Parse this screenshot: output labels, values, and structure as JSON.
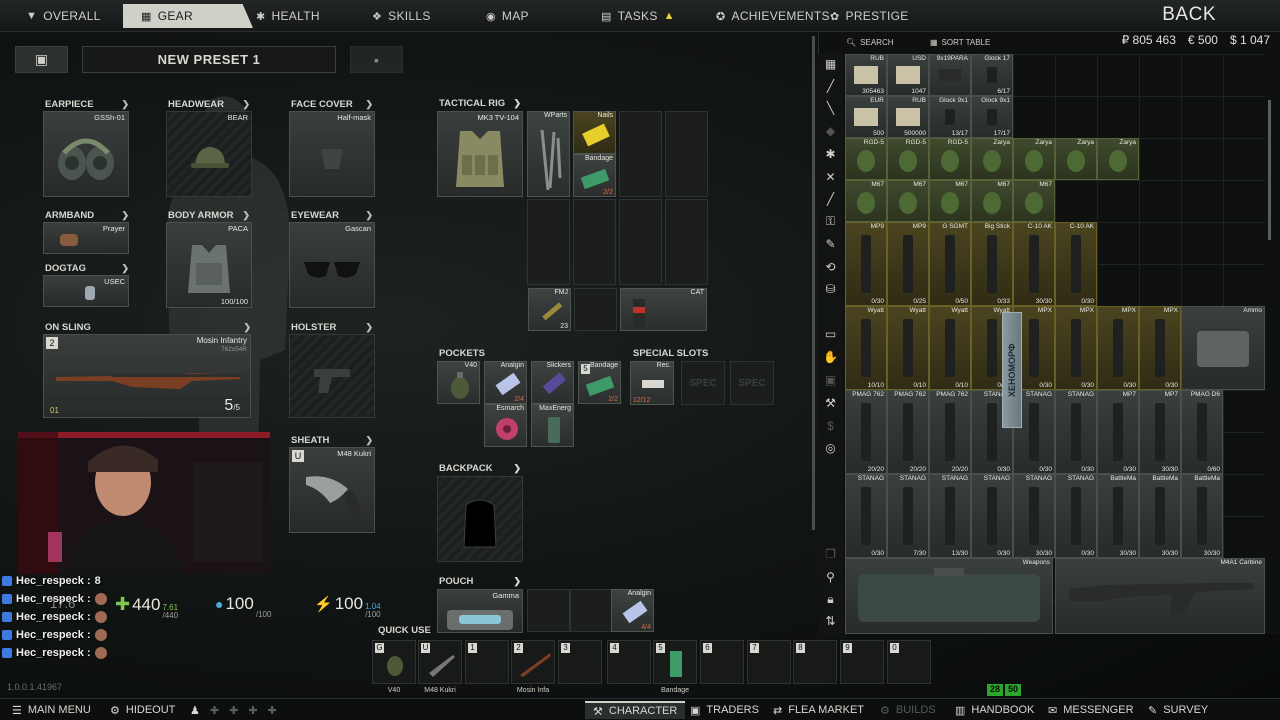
{
  "top_tabs": [
    {
      "label": "OVERALL",
      "icon": "person-icon"
    },
    {
      "label": "GEAR",
      "icon": "gear-icon"
    },
    {
      "label": "HEALTH",
      "icon": "health-icon"
    },
    {
      "label": "SKILLS",
      "icon": "skills-icon"
    },
    {
      "label": "MAP",
      "icon": "map-pin-icon"
    },
    {
      "label": "TASKS",
      "icon": "tasks-icon"
    },
    {
      "label": "ACHIEVEMENTS",
      "icon": "achievements-icon"
    },
    {
      "label": "PRESTIGE",
      "icon": "prestige-icon"
    }
  ],
  "back_label": "BACK",
  "preset": {
    "name": "NEW PRESET 1"
  },
  "equipment": {
    "earpiece": {
      "label": "EARPIECE",
      "item": "GSSh-01"
    },
    "headwear": {
      "label": "HEADWEAR",
      "item": "BEAR"
    },
    "face_cover": {
      "label": "FACE COVER",
      "item": "Half-mask"
    },
    "armband": {
      "label": "ARMBAND",
      "item": "Prayer"
    },
    "body_armor": {
      "label": "BODY ARMOR",
      "item": "PACA",
      "durability": "100/100"
    },
    "eyewear": {
      "label": "EYEWEAR",
      "item": "Gascan"
    },
    "dogtag": {
      "label": "DOGTAG",
      "item": "USEC"
    },
    "on_sling": {
      "label": "ON SLING",
      "item": "Mosin Infantry",
      "caliber": "762x54R",
      "ammo": "5",
      "ammo_max": "/5",
      "slot_key": "2",
      "mode": "01"
    },
    "holster": {
      "label": "HOLSTER"
    },
    "sheath": {
      "label": "SHEATH",
      "item": "M48 Kukri",
      "slot_key": "U"
    }
  },
  "tactical_rig": {
    "label": "TACTICAL RIG",
    "item": "MK3 TV-104",
    "items": [
      {
        "name": "WParts",
        "qty": ""
      },
      {
        "name": "Nails",
        "qty": ""
      },
      {
        "name": "Bandage",
        "qty": "2/2"
      },
      {
        "name": "FMJ",
        "qty": "23"
      },
      {
        "name": "CAT",
        "qty": ""
      }
    ]
  },
  "pockets": {
    "label": "POCKETS",
    "items": [
      {
        "name": "V40",
        "qty": ""
      },
      {
        "name": "Analgin",
        "qty": "2/4"
      },
      {
        "name": "Slickers",
        "qty": ""
      },
      {
        "name": "Bandage",
        "qty": "2/2",
        "key": "5"
      },
      {
        "name": "Esmarch",
        "qty": ""
      },
      {
        "name": "MaxEnerg",
        "qty": ""
      }
    ]
  },
  "special_slots": {
    "label": "SPECIAL SLOTS",
    "items": [
      {
        "name": "Rec.",
        "qty": "12/12"
      },
      {
        "name": "SPEC",
        "qty": ""
      },
      {
        "name": "SPEC",
        "qty": ""
      }
    ]
  },
  "backpack": {
    "label": "BACKPACK"
  },
  "pouch": {
    "label": "POUCH",
    "item": "Gamma",
    "content": {
      "name": "Analgin",
      "qty": "4/4"
    }
  },
  "player_stats": {
    "health": {
      "value": "440",
      "max": "/440",
      "top": "7.61"
    },
    "hydration": {
      "value": "100",
      "max": "/100"
    },
    "energy": {
      "value": "100",
      "max": "/100",
      "top": "1.04"
    },
    "weight": {
      "value": "17.6"
    }
  },
  "chat": [
    {
      "user": "Hec_respeck :",
      "text": "8"
    },
    {
      "user": "Hec_respeck :",
      "text": ""
    },
    {
      "user": "Hec_respeck :",
      "text": ""
    },
    {
      "user": "Hec_respeck :",
      "text": ""
    },
    {
      "user": "Hec_respeck :",
      "text": ""
    }
  ],
  "quick_use": {
    "label": "QUICK USE",
    "slots": [
      {
        "key": "G",
        "label": "V40"
      },
      {
        "key": "U",
        "label": "M48 Kukri"
      },
      {
        "key": "1",
        "label": ""
      },
      {
        "key": "2",
        "label": "Mosin Infa"
      },
      {
        "key": "3",
        "label": ""
      },
      {
        "key": "4",
        "label": ""
      },
      {
        "key": "5",
        "label": "Bandage"
      },
      {
        "key": "6",
        "label": ""
      },
      {
        "key": "7",
        "label": ""
      },
      {
        "key": "8",
        "label": ""
      },
      {
        "key": "9",
        "label": ""
      },
      {
        "key": "0",
        "label": ""
      }
    ]
  },
  "version": "1.0.0.1.41967",
  "stash": {
    "search_label": "SEARCH",
    "sort_label": "SORT TABLE",
    "currency": {
      "rub": "₽ 805 463",
      "eur": "€ 500",
      "usd": "$ 1 047"
    },
    "rows": [
      [
        {
          "name": "RUB",
          "qty": "305463",
          "t": "money"
        },
        {
          "name": "USD",
          "qty": "1047",
          "t": "money"
        },
        {
          "name": "9x19PARA",
          "qty": "",
          "t": "ammo"
        },
        {
          "name": "Glock 17",
          "qty": "6/17",
          "t": "mag"
        }
      ],
      [
        {
          "name": "EUR",
          "qty": "500",
          "t": "money"
        },
        {
          "name": "RUB",
          "qty": "500000",
          "t": "money"
        },
        {
          "name": "Glock 9x1",
          "qty": "13/17",
          "t": "mag"
        },
        {
          "name": "Glock 9x1",
          "qty": "17/17",
          "t": "mag"
        }
      ],
      [
        {
          "name": "RGD-5",
          "qty": "",
          "t": "nade"
        },
        {
          "name": "RGD-5",
          "qty": "",
          "t": "nade"
        },
        {
          "name": "RGD-5",
          "qty": "",
          "t": "nade"
        },
        {
          "name": "Zarya",
          "qty": "",
          "t": "nade"
        },
        {
          "name": "Zarya",
          "qty": "",
          "t": "nade"
        },
        {
          "name": "Zarya",
          "qty": "",
          "t": "nade"
        },
        {
          "name": "Zarya",
          "qty": "",
          "t": "nade"
        }
      ],
      [
        {
          "name": "M67",
          "qty": "",
          "t": "nade"
        },
        {
          "name": "M67",
          "qty": "",
          "t": "nade"
        },
        {
          "name": "M67",
          "qty": "",
          "t": "nade"
        },
        {
          "name": "M67",
          "qty": "",
          "t": "nade"
        },
        {
          "name": "M67",
          "qty": "",
          "t": "nade"
        }
      ],
      [
        {
          "name": "MP9",
          "qty": "0/30",
          "t": "mag"
        },
        {
          "name": "MP9",
          "qty": "0/25",
          "t": "mag"
        },
        {
          "name": "G SGMT",
          "qty": "0/50",
          "t": "mag"
        },
        {
          "name": "Big Stick",
          "qty": "0/33",
          "t": "mag"
        },
        {
          "name": "C-10 AK",
          "qty": "30/30",
          "t": "mag"
        },
        {
          "name": "C-10 AK",
          "qty": "0/30",
          "t": "mag"
        }
      ],
      [
        {
          "name": "Wyatt",
          "qty": "10/10",
          "t": "mag"
        },
        {
          "name": "Wyatt",
          "qty": "0/10",
          "t": "mag"
        },
        {
          "name": "Wyatt",
          "qty": "0/10",
          "t": "mag"
        },
        {
          "name": "Wyatt",
          "qty": "0/30",
          "t": "mag"
        },
        {
          "name": "MPX",
          "qty": "0/30",
          "t": "mag"
        },
        {
          "name": "MPX",
          "qty": "0/30",
          "t": "mag"
        },
        {
          "name": "MPX",
          "qty": "0/30",
          "t": "mag"
        },
        {
          "name": "MPX",
          "qty": "0/30",
          "t": "mag"
        },
        {
          "name": "Ammo",
          "qty": "",
          "t": "case"
        }
      ],
      [
        {
          "name": "PMAG 762",
          "qty": "20/20",
          "t": "mag"
        },
        {
          "name": "PMAG 762",
          "qty": "20/20",
          "t": "mag"
        },
        {
          "name": "PMAG 762",
          "qty": "20/20",
          "t": "mag"
        },
        {
          "name": "STANAG",
          "qty": "0/30",
          "t": "mag"
        },
        {
          "name": "STANAG",
          "qty": "0/30",
          "t": "mag"
        },
        {
          "name": "STANAG",
          "qty": "0/30",
          "t": "mag"
        },
        {
          "name": "MP7",
          "qty": "0/30",
          "t": "mag"
        },
        {
          "name": "MP7",
          "qty": "30/30",
          "t": "mag"
        },
        {
          "name": "PMAG D6",
          "qty": "0/60",
          "t": "mag"
        }
      ],
      [
        {
          "name": "STANAG",
          "qty": "0/30",
          "t": "mag"
        },
        {
          "name": "STANAG",
          "qty": "7/30",
          "t": "mag"
        },
        {
          "name": "STANAG",
          "qty": "13/30",
          "t": "mag"
        },
        {
          "name": "STANAG",
          "qty": "0/30",
          "t": "mag"
        },
        {
          "name": "STANAG",
          "qty": "30/30",
          "t": "mag"
        },
        {
          "name": "STANAG",
          "qty": "0/30",
          "t": "mag"
        },
        {
          "name": "BattleMa",
          "qty": "30/30",
          "t": "mag"
        },
        {
          "name": "BattleMa",
          "qty": "30/30",
          "t": "mag"
        },
        {
          "name": "BattleMa",
          "qty": "30/30",
          "t": "mag"
        }
      ]
    ],
    "bottom_items": [
      {
        "name": "Weapons",
        "t": "case"
      },
      {
        "name": "M4A1 Carbine",
        "t": "gun"
      }
    ],
    "tooltip_text": "ХЕНОМОРФ"
  },
  "bottom_bar": {
    "items": [
      {
        "label": "MAIN MENU",
        "icon": "menu-icon"
      },
      {
        "label": "HIDEOUT",
        "icon": "hideout-icon"
      },
      {
        "label": "CHARACTER",
        "icon": "character-icon"
      },
      {
        "label": "TRADERS",
        "icon": "traders-icon"
      },
      {
        "label": "FLEA MARKET",
        "icon": "flea-market-icon"
      },
      {
        "label": "BUILDS",
        "icon": "builds-icon"
      },
      {
        "label": "HANDBOOK",
        "icon": "handbook-icon"
      },
      {
        "label": "MESSENGER",
        "icon": "messenger-icon"
      },
      {
        "label": "SURVEY",
        "icon": "survey-icon"
      }
    ],
    "fps": "28",
    "ping": "50"
  }
}
